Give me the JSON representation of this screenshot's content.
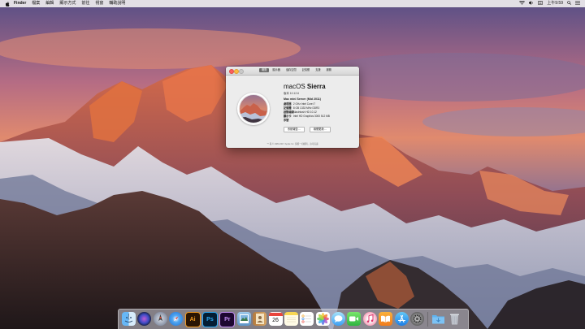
{
  "menubar": {
    "app_name": "Finder",
    "items": [
      "檔案",
      "編輯",
      "顯示方式",
      "前往",
      "視窗",
      "輔助說明"
    ],
    "clock": "上午9:59"
  },
  "about_window": {
    "tabs": [
      "概覽",
      "顯示器",
      "儲存空間",
      "記憶體",
      "支援",
      "服務"
    ],
    "os_name_light": "macOS",
    "os_name_bold": "Sierra",
    "version": "版本 10.12.6",
    "model": "Mac mini Server (Mid 2011)",
    "specs": [
      {
        "key": "處理器",
        "value": "2 GHz Intel Core i7"
      },
      {
        "key": "記憶體",
        "value": "8 GB 1333 MHz DDR3"
      },
      {
        "key": "啟動磁碟",
        "value": "Macintosh HD 10.12"
      },
      {
        "key": "顯示卡",
        "value": "Intel HD Graphics 3000 512 MB"
      },
      {
        "key": "序號",
        "value": ""
      }
    ],
    "buttons": [
      "系統報告…",
      "軟體更新…"
    ],
    "footer": "™ 與 © 1983-2017 Apple Inc. 保留一切權利。許可協議"
  },
  "dock": {
    "icons": [
      {
        "name": "finder",
        "glyph": ""
      },
      {
        "name": "siri",
        "glyph": ""
      },
      {
        "name": "launchpad",
        "glyph": ""
      },
      {
        "name": "safari",
        "glyph": ""
      },
      {
        "name": "illustrator",
        "glyph": "Ai"
      },
      {
        "name": "photoshop",
        "glyph": "Ps"
      },
      {
        "name": "premiere",
        "glyph": "Pr"
      },
      {
        "name": "preview",
        "glyph": ""
      },
      {
        "name": "contacts",
        "glyph": ""
      },
      {
        "name": "calendar",
        "glyph": "26"
      },
      {
        "name": "notes",
        "glyph": ""
      },
      {
        "name": "reminders",
        "glyph": ""
      },
      {
        "name": "photos",
        "glyph": ""
      },
      {
        "name": "messages",
        "glyph": ""
      },
      {
        "name": "facetime",
        "glyph": ""
      },
      {
        "name": "itunes",
        "glyph": ""
      },
      {
        "name": "ibooks",
        "glyph": ""
      },
      {
        "name": "app-store",
        "glyph": ""
      },
      {
        "name": "system-preferences",
        "glyph": ""
      },
      {
        "name": "downloads-folder",
        "glyph": ""
      },
      {
        "name": "trash",
        "glyph": ""
      }
    ]
  }
}
